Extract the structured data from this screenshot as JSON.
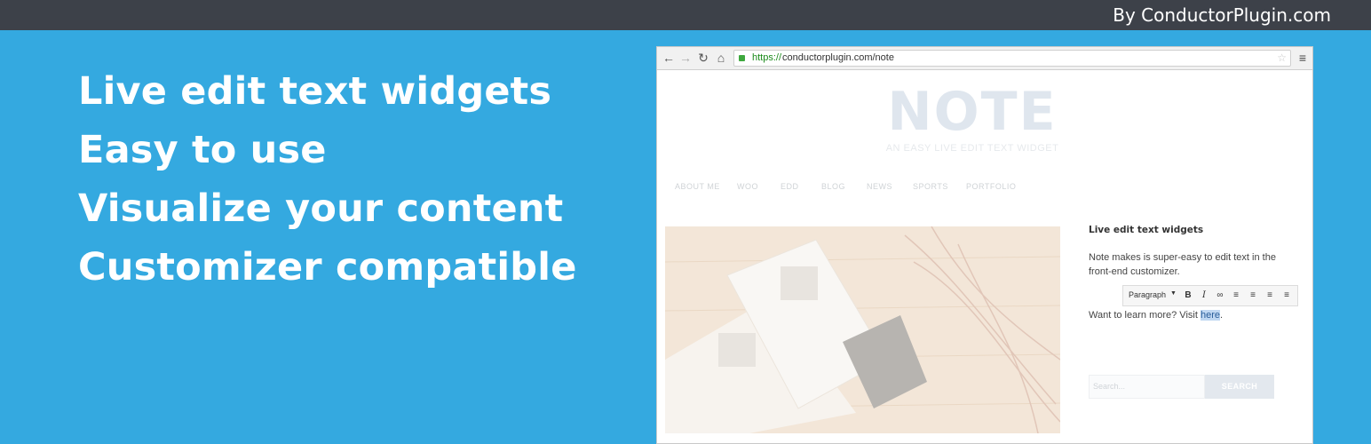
{
  "header": {
    "byline": "By ConductorPlugin.com"
  },
  "features": [
    "Live edit text widgets",
    "Easy to use",
    "Visualize your content",
    "Customizer compatible"
  ],
  "browser": {
    "url_scheme": "https://",
    "url_rest": "conductorplugin.com/note"
  },
  "site": {
    "title": "NOTE",
    "tagline": "AN EASY LIVE EDIT TEXT WIDGET",
    "nav": [
      "ABOUT ME",
      "WOO",
      "EDD",
      "BLOG",
      "NEWS",
      "SPORTS",
      "PORTFOLIO"
    ]
  },
  "widget": {
    "title": "Live edit text widgets",
    "text": "Note makes is super-easy to edit text in the front-end customizer.",
    "learn_prefix": "Want to learn more? Visit ",
    "learn_link": "here",
    "learn_suffix": "."
  },
  "editor_toolbar": {
    "format": "Paragraph"
  },
  "search": {
    "placeholder": "Search...",
    "button": "SEARCH"
  }
}
